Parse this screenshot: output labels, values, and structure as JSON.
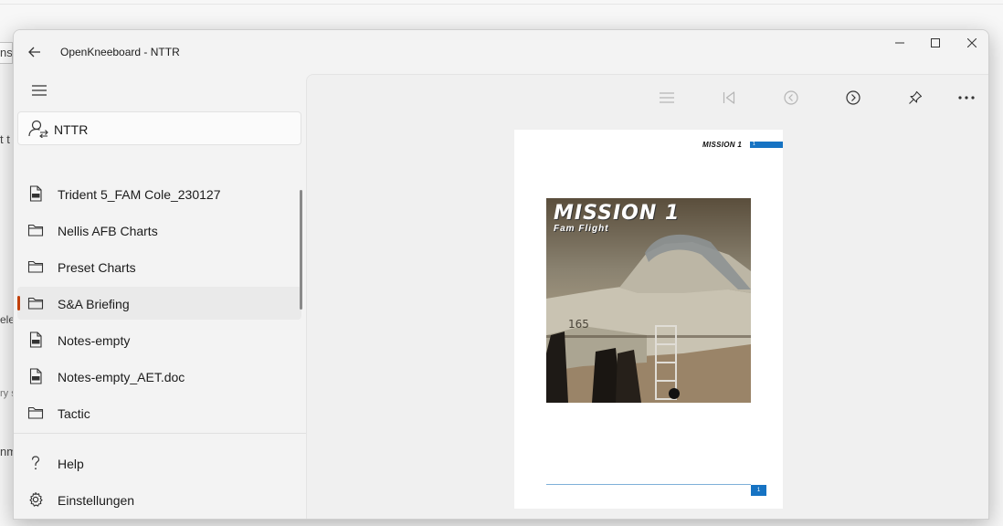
{
  "background_window": {
    "fragments": [
      "ns",
      "t t",
      "ele",
      "ry s",
      "nm"
    ]
  },
  "window": {
    "title": "OpenKneeboard - NTTR",
    "controls": {
      "minimize": "minimize-icon",
      "maximize": "maximize-icon",
      "close": "close-icon"
    }
  },
  "sidebar": {
    "profile": "NTTR",
    "items": [
      {
        "label": "Trident 5_FAM Cole_230127",
        "icon": "pdf-file-icon",
        "selected": false
      },
      {
        "label": "Nellis AFB Charts",
        "icon": "folder-icon",
        "selected": false
      },
      {
        "label": "Preset Charts",
        "icon": "folder-icon",
        "selected": false
      },
      {
        "label": "S&A Briefing",
        "icon": "folder-icon",
        "selected": true
      },
      {
        "label": "Notes-empty",
        "icon": "pdf-file-icon",
        "selected": false
      },
      {
        "label": "Notes-empty_AET.doc",
        "icon": "pdf-file-icon",
        "selected": false
      },
      {
        "label": "Tactic",
        "icon": "folder-icon",
        "selected": false
      }
    ],
    "footer": {
      "help": "Help",
      "settings": "Einstellungen"
    }
  },
  "toolbar": {
    "buttons": [
      "toc-icon",
      "first-page-icon",
      "previous-page-icon",
      "next-page-icon",
      "pin-icon",
      "more-icon"
    ]
  },
  "document_page": {
    "header_text": "MISSION 1",
    "header_tab": "1",
    "image_title": "MISSION 1",
    "image_subtitle": "Fam Flight",
    "aircraft_number": "165",
    "page_number": "1"
  },
  "colors": {
    "accent_indicator": "#c2410c",
    "page_accent": "#1673c3"
  }
}
